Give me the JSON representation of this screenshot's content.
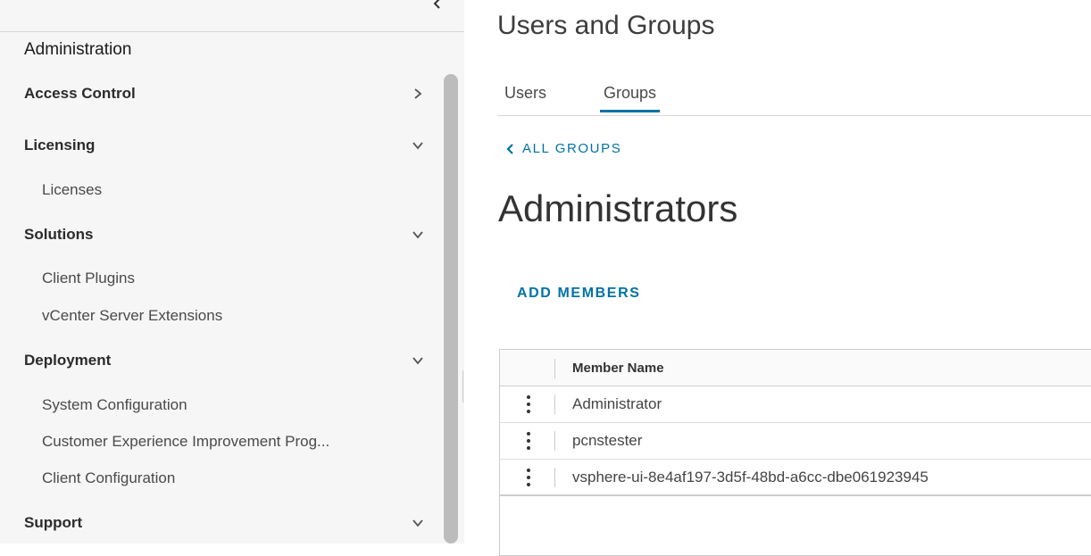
{
  "sidebar": {
    "title": "Administration",
    "sections": [
      {
        "label": "Access Control",
        "icon": "chevron-right-icon",
        "items": []
      },
      {
        "label": "Licensing",
        "icon": "chevron-down-icon",
        "items": [
          "Licenses"
        ]
      },
      {
        "label": "Solutions",
        "icon": "chevron-down-icon",
        "items": [
          "Client Plugins",
          "vCenter Server Extensions"
        ]
      },
      {
        "label": "Deployment",
        "icon": "chevron-down-icon",
        "items": [
          "System Configuration",
          "Customer Experience Improvement Prog...",
          "Client Configuration"
        ]
      },
      {
        "label": "Support",
        "icon": "chevron-down-icon",
        "items": []
      }
    ]
  },
  "main": {
    "title": "Users and Groups",
    "tabs": [
      {
        "label": "Users",
        "active": false
      },
      {
        "label": "Groups",
        "active": true
      }
    ],
    "back_link": "ALL GROUPS",
    "group_name": "Administrators",
    "add_members_label": "ADD MEMBERS",
    "table": {
      "column_header": "Member Name",
      "rows": [
        "Administrator",
        "pcnstester",
        "vsphere-ui-8e4af197-3d5f-48bd-a6cc-dbe061923945"
      ]
    }
  },
  "colors": {
    "accent": "#0072a3",
    "sidebar_bg": "#f6f6f6"
  }
}
